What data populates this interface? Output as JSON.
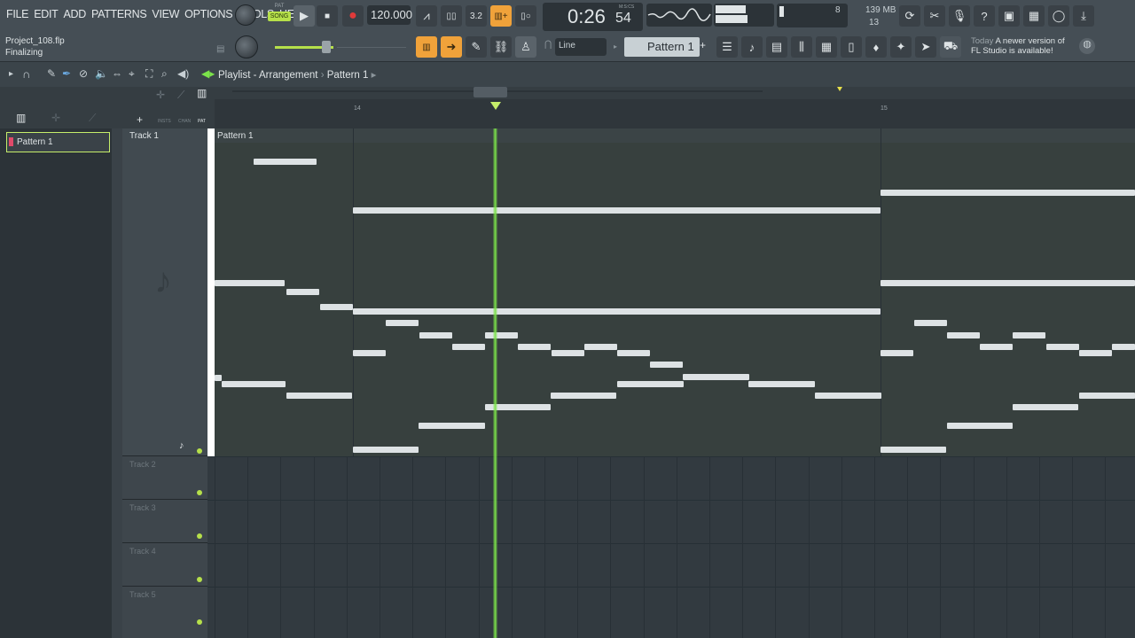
{
  "menu": [
    "FILE",
    "EDIT",
    "ADD",
    "PATTERNS",
    "VIEW",
    "OPTIONS",
    "TOOLS",
    "HELP"
  ],
  "project": {
    "file": "Project_108.flp",
    "status": "Finalizing"
  },
  "transport": {
    "pat_label": "PAT",
    "song_label": "SONG",
    "tempo": "120.000",
    "time_main": "0:26",
    "time_sub": "54",
    "time_unit": "M:S:CS"
  },
  "monitor": {
    "cpu": "8",
    "memory": "139 MB",
    "voices": "13"
  },
  "snap": "Line",
  "pattern_selector": "Pattern 1",
  "news": {
    "when": "Today",
    "message": "A newer version of FL Studio is available!"
  },
  "breadcrumb": {
    "title": "Playlist - Arrangement",
    "separator": "›",
    "current": "Pattern 1"
  },
  "header_tabs": [
    "INSTS",
    "CHAN",
    "PAT"
  ],
  "ruler": {
    "mark1": "14",
    "mark2": "15"
  },
  "picker": {
    "item": "Pattern 1"
  },
  "tracks": [
    "Track 1",
    "Track 2",
    "Track 3",
    "Track 4",
    "Track 5"
  ],
  "clip": {
    "title": "Pattern 1"
  },
  "colors": {
    "accent": "#f0a23a",
    "playhead": "#7be24a",
    "note": "#dde2e4",
    "led": "#b6e04a"
  },
  "icons": [
    "tempo-knob",
    "play-icon",
    "stop-icon",
    "record-icon",
    "metronome-icon",
    "undo-icon",
    "cut-icon",
    "mic-icon",
    "help-icon",
    "save-icon",
    "chat-icon",
    "download-icon",
    "magnet-icon",
    "pencil-icon",
    "brush-icon",
    "mute-icon",
    "zoom-icon",
    "speaker-icon",
    "mixer-icon",
    "piano-roll-icon",
    "browser-icon",
    "plugin-icon",
    "cart-icon"
  ]
}
